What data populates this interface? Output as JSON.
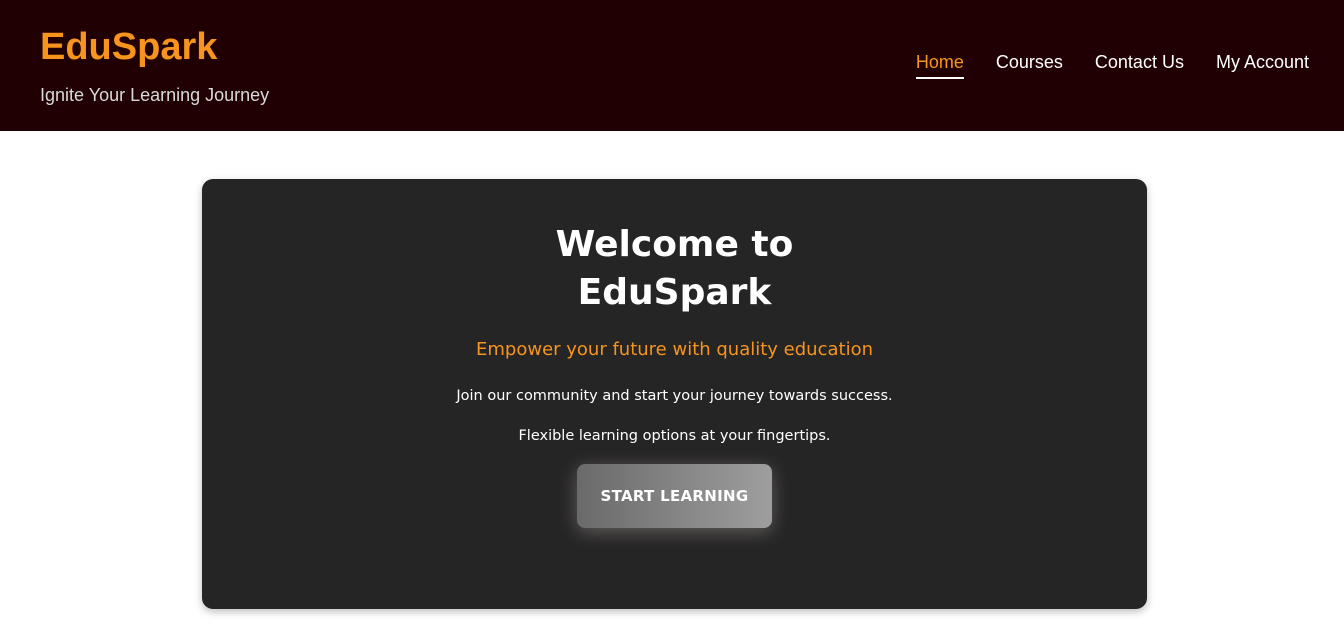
{
  "header": {
    "brand": "EduSpark",
    "tagline": "Ignite Your Learning Journey",
    "nav": [
      {
        "label": "Home",
        "active": true
      },
      {
        "label": "Courses",
        "active": false
      },
      {
        "label": "Contact Us",
        "active": false
      },
      {
        "label": "My Account",
        "active": false
      }
    ]
  },
  "hero": {
    "title_line1": "Welcome to",
    "title_line2": "EduSpark",
    "subtitle": "Empower your future with quality education",
    "text1": "Join our community and start your journey towards success.",
    "text2": "Flexible learning options at your fingertips.",
    "cta_label": "START LEARNING"
  },
  "colors": {
    "header_bg": "#200003",
    "accent": "#f7941d",
    "hero_bg": "#262526",
    "page_bg": "#ffffff"
  }
}
